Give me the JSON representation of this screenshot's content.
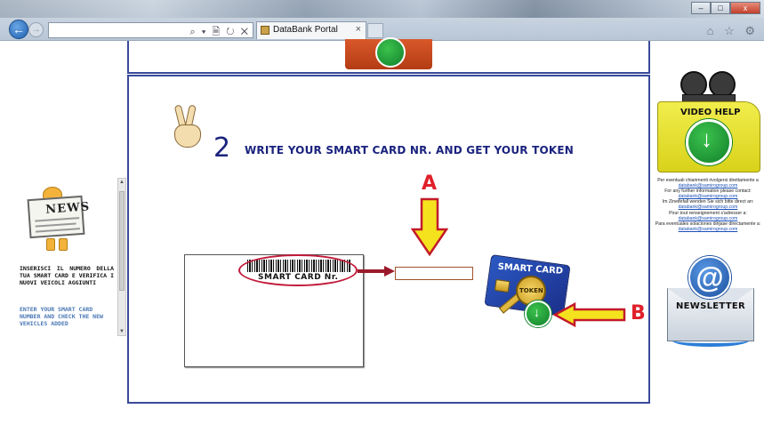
{
  "browser": {
    "tab_title": "DataBank Portal",
    "address_value": "",
    "address_icons": "⌕ ▾ 🗎 ↻ ✕",
    "tab_close": "×",
    "right_icons": "⌂ ☆ ⚙",
    "win_min": "–",
    "win_max": "□",
    "win_close": "x"
  },
  "left": {
    "news_heading": "NEWS",
    "text_it": "INSERISCI IL NUMERO DELLA TUA SMART CARD E VERIFICA I NUOVI VEICOLI AGGIUNTI",
    "text_en": "ENTER YOUR SMART CARD NUMBER AND CHECK THE NEW VEHICLES ADDED"
  },
  "main": {
    "step_number": "2",
    "step_title": "WRITE YOUR SMART CARD NR. AND GET YOUR TOKEN",
    "label_a": "A",
    "label_b": "B",
    "card_label": "SMART CARD Nr.",
    "card_input_value": "",
    "token_card_text": "SMART CARD",
    "token_key_text": "TOKEN"
  },
  "right": {
    "video_help_label": "VIDEO HELP",
    "contact_lines": [
      "Per eventuali chiarimenti rivolgersi direttamente a",
      "databank@samirogroup.com",
      "For any further information please contact:",
      "databank@samirogroup.com",
      "Im Zineifefall wenden Sie sich bitte direct an:",
      "databank@samirogroup.com",
      "Pour tout renseignement s'adresser a:",
      "databank@samirogroup.com",
      "Para eventuales solaciones dirijase directamente a:",
      "databank@samirogroup.com"
    ],
    "newsletter_label": "NEWSLETTER"
  },
  "colors": {
    "frame_border": "#3a4a9a",
    "title_blue": "#1a237e",
    "marker_red": "#e0202a",
    "arrow_yellow": "#f5e21e",
    "download_green": "#1f9e37"
  },
  "icons": [
    "back-arrow-icon",
    "forward-arrow-icon",
    "search-icon",
    "refresh-icon",
    "home-icon",
    "favorites-star-icon",
    "settings-gear-icon",
    "news-icon",
    "victory-hand-icon",
    "down-arrow-icon",
    "left-arrow-icon",
    "smart-card-token-icon",
    "download-icon",
    "video-help-icon",
    "newsletter-icon"
  ]
}
